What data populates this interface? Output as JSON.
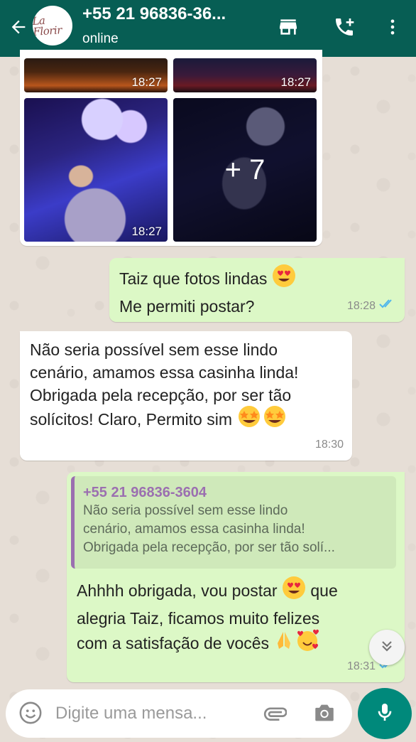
{
  "header": {
    "contact_name": "+55 21 96836-36...",
    "status": "online",
    "avatar_text": "La Florir",
    "icons": [
      "back-arrow-icon",
      "store-icon",
      "add-call-icon",
      "more-vert-icon"
    ]
  },
  "media": {
    "times": [
      "18:27",
      "18:27",
      "18:27",
      "18:27"
    ],
    "more_count": "+ 7"
  },
  "messages": {
    "m1": {
      "line1": "Taiz que fotos lindas",
      "line2": "Me permiti postar?",
      "time": "18:28",
      "status": "read"
    },
    "m2": {
      "line1": "Não seria possível sem esse lindo",
      "line2": "cenário, amamos essa casinha linda!",
      "line3": "Obrigada pela recepção, por ser tão",
      "line4": "solícitos!  Claro, Permito sim",
      "time": "18:30"
    },
    "m3": {
      "quote_author": "+55 21 96836-3604",
      "quote_line1": "Não seria possível sem esse lindo",
      "quote_line2": "cenário, amamos essa casinha linda!",
      "quote_line3": "Obrigada pela recepção, por ser tão solí...",
      "line1a": "Ahhhh obrigada, vou postar",
      "line1b": "que",
      "line2": "alegria Taiz,  ficamos muito felizes",
      "line3": "com a satisfação de vocês",
      "time": "18:31",
      "status": "read"
    }
  },
  "composer": {
    "placeholder": "Digite uma mensa..."
  },
  "colors": {
    "header": "#075e54",
    "outgoing_bubble": "#dcf8c6",
    "incoming_bubble": "#ffffff",
    "read_ticks": "#4fb6ec",
    "mic_fab": "#00897b"
  }
}
